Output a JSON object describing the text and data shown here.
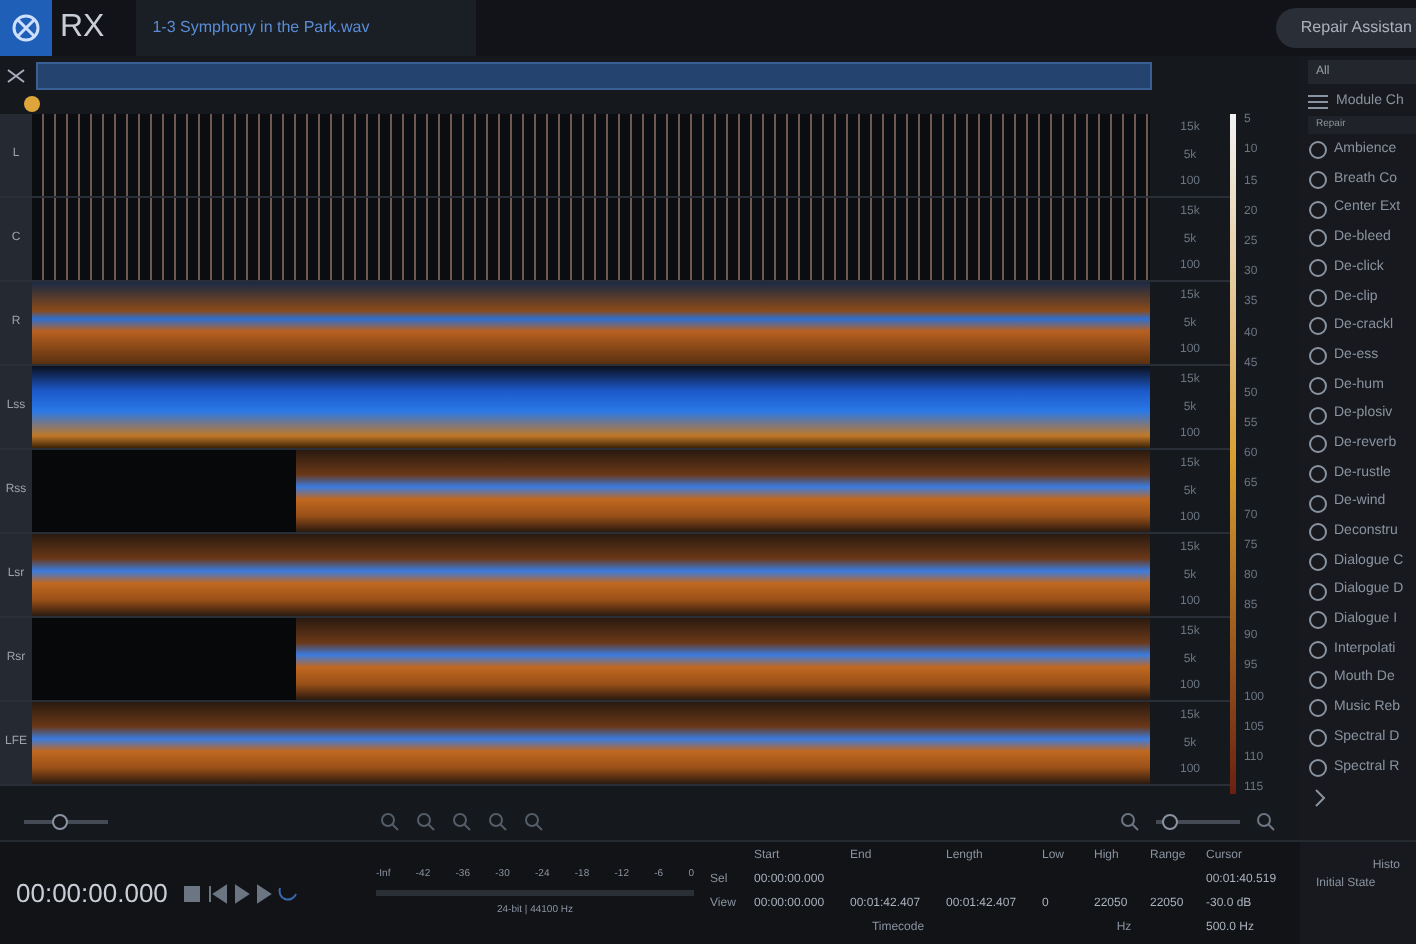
{
  "app": {
    "logo": "RX",
    "file_tab": "1-3 Symphony in the Park.wav",
    "assistant_button": "Repair Assistan"
  },
  "channels": [
    {
      "label": "L",
      "kind": "waveform",
      "silent_start": false,
      "freqs": [
        "15k",
        "5k",
        "100"
      ]
    },
    {
      "label": "C",
      "kind": "waveform",
      "silent_start": false,
      "freqs": [
        "15k",
        "5k",
        "100"
      ]
    },
    {
      "label": "R",
      "kind": "bursts",
      "silent_start": false,
      "freqs": [
        "15k",
        "5k",
        "100"
      ]
    },
    {
      "label": "Lss",
      "kind": "dense",
      "silent_start": false,
      "freqs": [
        "15k",
        "5k",
        "100"
      ]
    },
    {
      "label": "Rss",
      "kind": "spectral",
      "silent_start": true,
      "freqs": [
        "15k",
        "5k",
        "100"
      ]
    },
    {
      "label": "Lsr",
      "kind": "spectral",
      "silent_start": false,
      "freqs": [
        "15k",
        "5k",
        "100"
      ]
    },
    {
      "label": "Rsr",
      "kind": "spectral",
      "silent_start": true,
      "freqs": [
        "15k",
        "5k",
        "100"
      ]
    },
    {
      "label": "LFE",
      "kind": "spectral",
      "silent_start": false,
      "freqs": [
        "15k",
        "5k",
        "100"
      ]
    }
  ],
  "zoom_sliders": [
    {
      "level": 0.4
    },
    {
      "level": 0.1
    }
  ],
  "db_scale": [
    "5",
    "10",
    "15",
    "20",
    "25",
    "30",
    "35",
    "40",
    "45",
    "50",
    "55",
    "60",
    "65",
    "70",
    "75",
    "80",
    "85",
    "90",
    "95",
    "100",
    "105",
    "110",
    "115"
  ],
  "modules": {
    "filter": "All",
    "chain": "Module Ch",
    "group": "Repair",
    "items": [
      "Ambience",
      "Breath Co",
      "Center Ext",
      "De-bleed",
      "De-click",
      "De-clip",
      "De-crackl",
      "De-ess",
      "De-hum",
      "De-plosiv",
      "De-reverb",
      "De-rustle",
      "De-wind",
      "Deconstru",
      "Dialogue C",
      "Dialogue D",
      "Dialogue I",
      "Interpolati",
      "Mouth De",
      "Music Reb",
      "Spectral D",
      "Spectral R"
    ]
  },
  "transport": {
    "time": "00:00:00.000",
    "meter_ticks": [
      "-Inf",
      "-42",
      "-36",
      "-30",
      "-24",
      "-18",
      "-12",
      "-6",
      "0"
    ],
    "format": "24-bit | 44100 Hz"
  },
  "selection": {
    "columns": [
      "Start",
      "End",
      "Length",
      "Low",
      "High",
      "Range",
      "Cursor"
    ],
    "rows": [
      {
        "label": "Sel",
        "cells": [
          "00:00:00.000",
          "",
          "",
          "",
          "",
          "",
          "00:01:40.519"
        ]
      },
      {
        "label": "View",
        "cells": [
          "00:00:00.000",
          "00:01:42.407",
          "00:01:42.407",
          "0",
          "22050",
          "22050",
          "-30.0 dB"
        ]
      }
    ],
    "extra": "500.0 Hz",
    "time_unit": "Timecode",
    "freq_unit": "Hz"
  },
  "history": {
    "title": "Histo",
    "items": [
      "Initial State"
    ]
  }
}
